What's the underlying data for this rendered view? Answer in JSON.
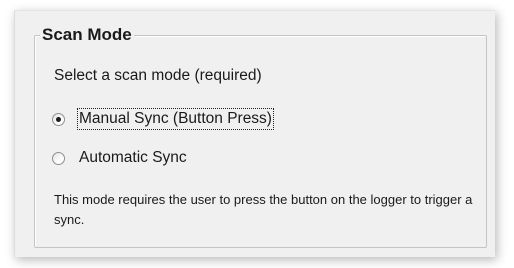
{
  "group": {
    "title": "Scan Mode",
    "prompt": "Select a scan mode (required)",
    "options": [
      {
        "label": "Manual Sync (Button Press)",
        "selected": true
      },
      {
        "label": "Automatic Sync",
        "selected": false
      }
    ],
    "description": "This mode requires the user to press the button on the logger to trigger a sync."
  }
}
